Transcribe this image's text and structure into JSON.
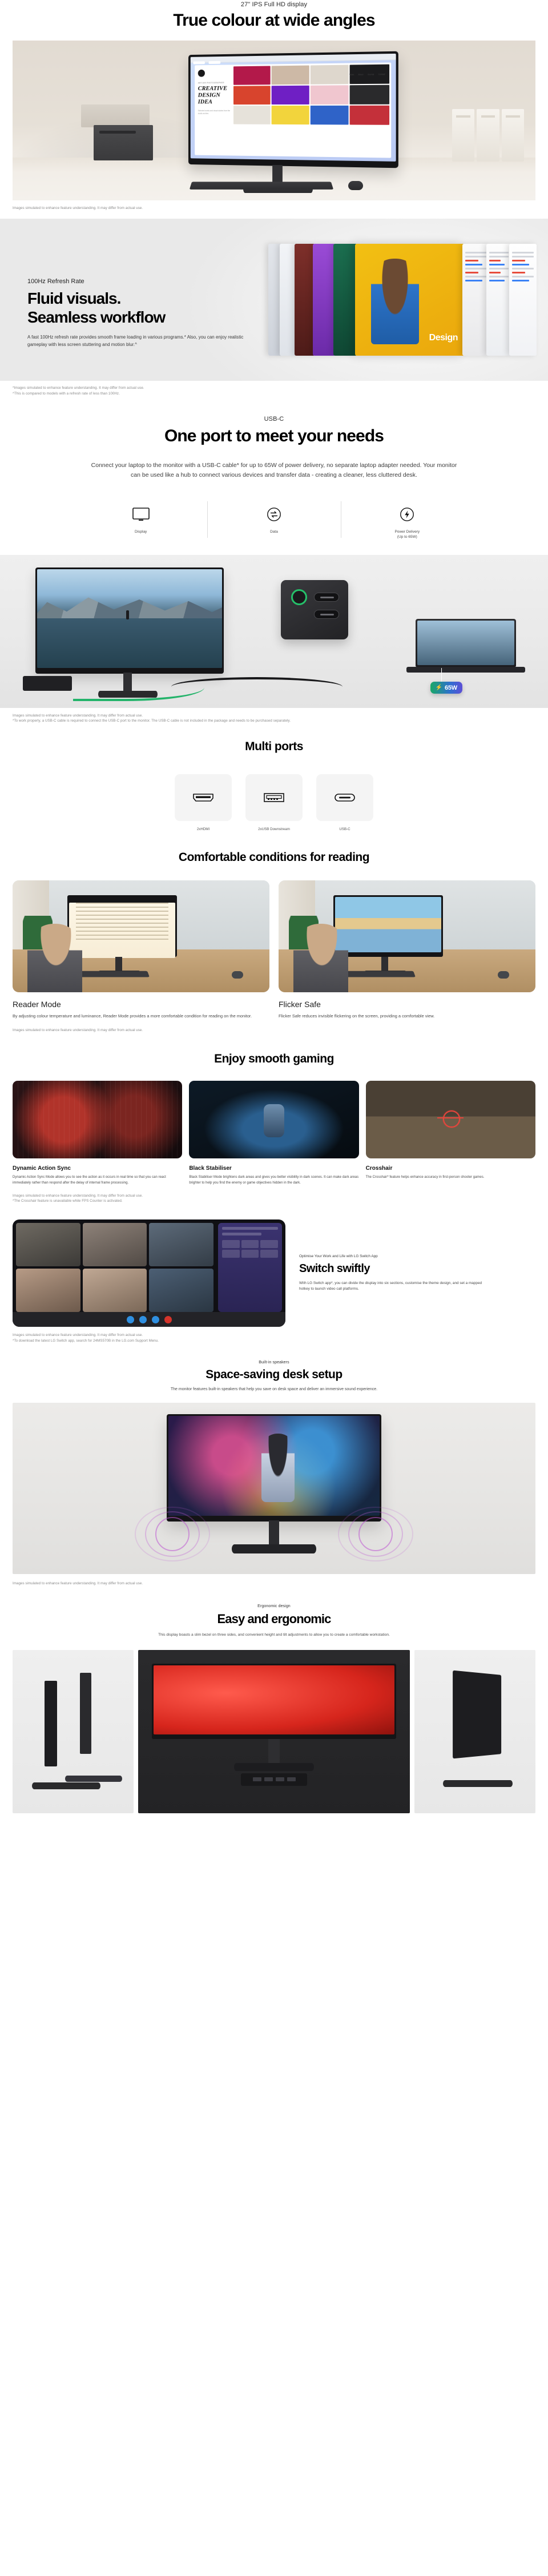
{
  "sections": {
    "wide_angles": {
      "eyebrow": "27\" IPS Full HD display",
      "title": "True colour at wide angles",
      "disclaimer": "Images simulated to enhance feature understanding. It may differ from actual use.",
      "screen_site": {
        "brand_label": "ART.DIR PHOTOGRAPHER",
        "headline": "CREATIVE DESIGN IDEA",
        "blurb": "Selected works and visual stories from the studio archive.",
        "nav": [
          "Work",
          "About",
          "Journal",
          "Contact"
        ]
      }
    },
    "fluid_visuals": {
      "kicker": "100Hz Refresh Rate",
      "title_line1": "Fluid visuals.",
      "title_line2": "Seamless workflow",
      "body": "A fast 100Hz refresh rate provides smooth frame loading in various programs.* Also, you can enjoy realistic gameplay with less screen stuttering and motion blur.^",
      "panel_label": "Design",
      "disclaimer_1": "*Images simulated to enhance feature understanding. It may differ from actual use.",
      "disclaimer_2": "^This is compared to models with a refresh rate of less than 100Hz."
    },
    "usb_c": {
      "eyebrow": "USB-C",
      "title": "One port to meet your needs",
      "body": "Connect your laptop to the monitor with a USB-C cable* for up to 65W of power delivery, no separate laptop adapter needed.  Your monitor can be used like a hub to connect various devices and transfer data - creating a cleaner, less cluttered desk.",
      "features": [
        {
          "icon": "display-icon",
          "label": "Display"
        },
        {
          "icon": "data-transfer-icon",
          "label": "Data"
        },
        {
          "icon": "power-delivery-icon",
          "label": "Power Delivery",
          "sublabel": "(Up to 65W)"
        }
      ],
      "badge": "65W",
      "disclaimer_1": "Images simulated to enhance feature understanding. It may differ from actual use.",
      "disclaimer_2": "*To work properly, a USB-C cable is required to connect the USB-C port to the monitor. The USB-C cable is not included in the package and needs to be purchased separately."
    },
    "multi_ports": {
      "title": "Multi ports",
      "ports": [
        {
          "icon": "hdmi-port-icon",
          "label": "2xHDMI"
        },
        {
          "icon": "usb-a-port-icon",
          "label": "2xUSB Downstream"
        },
        {
          "icon": "usb-c-port-icon",
          "label": "USB-C"
        }
      ]
    },
    "reading": {
      "title": "Comfortable conditions for reading",
      "cards": [
        {
          "title": "Reader Mode",
          "body": "By adjusting colour temperature and luminance, Reader Mode provides a more comfortable condition for reading on the monitor."
        },
        {
          "title": "Flicker Safe",
          "body": "Flicker Safe reduces invisible flickering on the screen, providing a comfortable view."
        }
      ],
      "disclaimer": "Images simulated to enhance feature understanding. It may differ from actual use."
    },
    "gaming": {
      "title": "Enjoy smooth gaming",
      "cards": [
        {
          "title": "Dynamic Action Sync",
          "body": "Dynamic Action Sync Mode allows you to see the action as it occurs in real time so that you can react immediately rather than respond after the delay of internal frame processing."
        },
        {
          "title": "Black Stabiliser",
          "body": "Black Stabiliser Mode brightens dark areas and gives you better visibility in dark scenes. It can make dark areas brighter to help you find the enemy or game objectives hidden in the dark."
        },
        {
          "title": "Crosshair",
          "body": "The Crosshair* feature helps enhance accuracy in first-person shooter games."
        }
      ],
      "disclaimer_1": "Images simulated to enhance feature understanding. It may differ from actual use.",
      "disclaimer_2": "*The Crosshair feature is unavailable while FPS Counter is activated."
    },
    "switch": {
      "kicker": "Optimise Your Work and Life with LG Switch App",
      "title": "Switch swiftly",
      "body": "With LG Switch app*, you can divide the display into six sections, customise the theme design, and set a mapped hotkey to launch video call platforms.",
      "disclaimer_1": "Images simulated to enhance feature understanding. It may differ from actual use.",
      "disclaimer_2": "*To download the latest LG Switch app, search for 24MS570B in the LG.com Support Menu."
    },
    "speakers": {
      "eyebrow": "Built-in speakers",
      "title": "Space-saving desk setup",
      "subtitle": "The monitor features built-in speakers that help you save on desk space and deliver an immersive sound experience.",
      "disclaimer": "Images simulated to enhance feature understanding. It may differ from actual use."
    },
    "ergonomic": {
      "eyebrow": "Ergonomic design",
      "title": "Easy and ergonomic",
      "subtitle": "This display boasts a slim bezel on three sides, and convenient height and tilt adjustments to allow you to create a comfortable workstation."
    }
  },
  "colors": {
    "accent_green": "#19a867",
    "accent_blue": "#2f6fd0",
    "accent_purple": "#5d4fd6",
    "text_primary": "#000000",
    "text_secondary": "#4a4a4a",
    "disclaimer": "#8b8b8b"
  }
}
